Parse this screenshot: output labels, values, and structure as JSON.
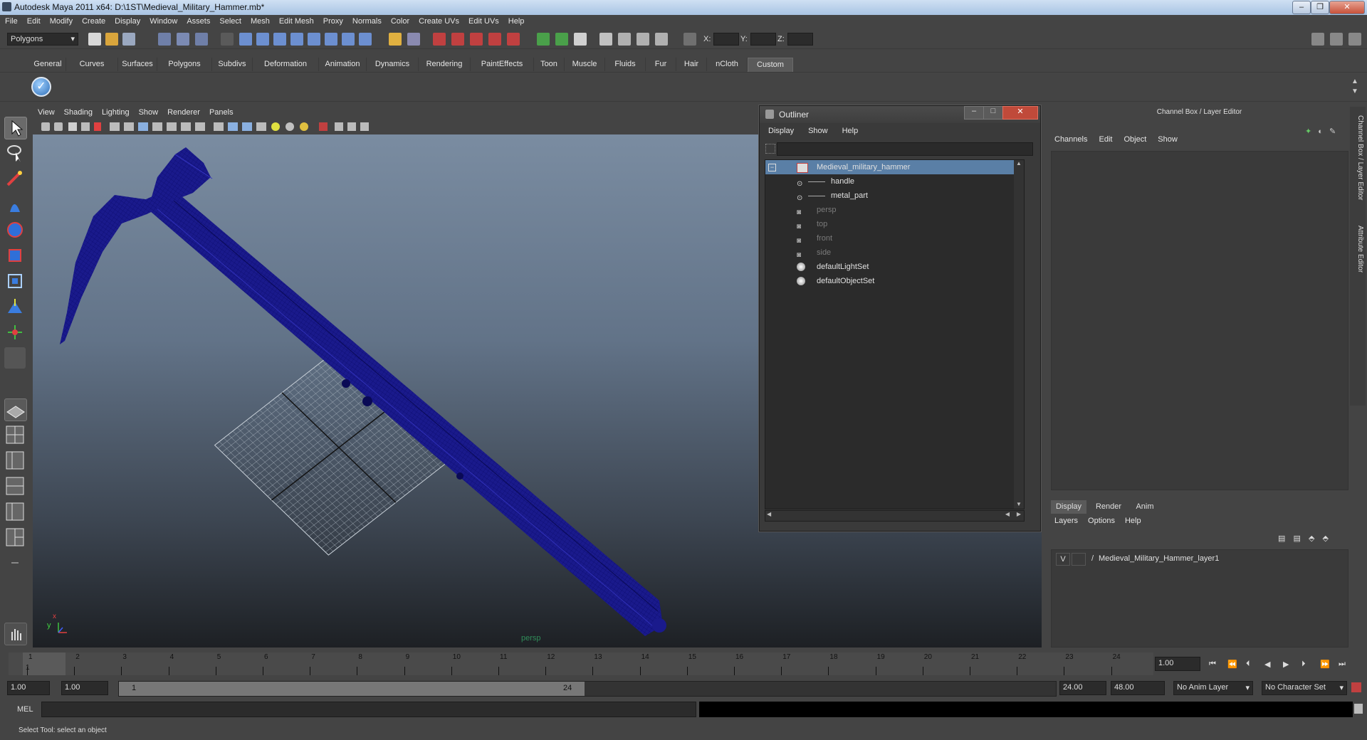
{
  "window": {
    "title": "Autodesk Maya 2011 x64: D:\\1ST\\Medieval_Military_Hammer.mb*"
  },
  "menubar": [
    "File",
    "Edit",
    "Modify",
    "Create",
    "Display",
    "Window",
    "Assets",
    "Select",
    "Mesh",
    "Edit Mesh",
    "Proxy",
    "Normals",
    "Color",
    "Create UVs",
    "Edit UVs",
    "Help"
  ],
  "statusline": {
    "mode": "Polygons",
    "x_label": "X:",
    "y_label": "Y:",
    "z_label": "Z:"
  },
  "shelf": {
    "tabs": [
      "General",
      "Curves",
      "Surfaces",
      "Polygons",
      "Subdivs",
      "Deformation",
      "Animation",
      "Dynamics",
      "Rendering",
      "PaintEffects",
      "Toon",
      "Muscle",
      "Fluids",
      "Fur",
      "Hair",
      "nCloth",
      "Custom"
    ],
    "active_tab": "Custom"
  },
  "viewport": {
    "menu": [
      "View",
      "Shading",
      "Lighting",
      "Show",
      "Renderer",
      "Panels"
    ],
    "camera_label": "persp",
    "axis_x": "x",
    "axis_y": "y"
  },
  "outliner": {
    "title": "Outliner",
    "menu": [
      "Display",
      "Show",
      "Help"
    ],
    "items": [
      {
        "label": "Medieval_military_hammer",
        "selected": true,
        "dim": false,
        "icon": "group-icon"
      },
      {
        "label": "handle",
        "selected": false,
        "dim": false,
        "icon": "mesh-icon"
      },
      {
        "label": "metal_part",
        "selected": false,
        "dim": false,
        "icon": "mesh-icon"
      },
      {
        "label": "persp",
        "selected": false,
        "dim": true,
        "icon": "camera-icon"
      },
      {
        "label": "top",
        "selected": false,
        "dim": true,
        "icon": "camera-icon"
      },
      {
        "label": "front",
        "selected": false,
        "dim": true,
        "icon": "camera-icon"
      },
      {
        "label": "side",
        "selected": false,
        "dim": true,
        "icon": "camera-icon"
      },
      {
        "label": "defaultLightSet",
        "selected": false,
        "dim": false,
        "icon": "set-icon"
      },
      {
        "label": "defaultObjectSet",
        "selected": false,
        "dim": false,
        "icon": "set-icon"
      }
    ]
  },
  "channelbox": {
    "title": "Channel Box / Layer Editor",
    "menu": [
      "Channels",
      "Edit",
      "Object",
      "Show"
    ],
    "layer_tabs": [
      "Display",
      "Render",
      "Anim"
    ],
    "active_layer_tab": "Display",
    "layer_menu": [
      "Layers",
      "Options",
      "Help"
    ],
    "layers": [
      {
        "visible": "V",
        "name": "Medieval_Military_Hammer_layer1"
      }
    ],
    "side_tabs": [
      "Channel Box / Layer Editor",
      "Attribute Editor"
    ]
  },
  "timeslider": {
    "ticks": [
      "1",
      "2",
      "3",
      "4",
      "5",
      "6",
      "7",
      "8",
      "9",
      "10",
      "11",
      "12",
      "13",
      "14",
      "15",
      "16",
      "17",
      "18",
      "19",
      "20",
      "21",
      "22",
      "23",
      "24"
    ],
    "current_frame_marker": "1",
    "current_time": "1.00"
  },
  "rangeslider": {
    "start_time": "1.00",
    "playback_start": "1.00",
    "range_start_label": "1",
    "range_end_label": "24",
    "playback_end": "24.00",
    "end_time": "48.00",
    "anim_layer": "No Anim Layer",
    "character_set": "No Character Set"
  },
  "commandline": {
    "label": "MEL"
  },
  "helpline": {
    "text": "Select Tool: select an object"
  },
  "colors": {
    "selection": "#5a7fa6",
    "wireframe": "#1a1a8c",
    "ui_bg": "#444444"
  }
}
